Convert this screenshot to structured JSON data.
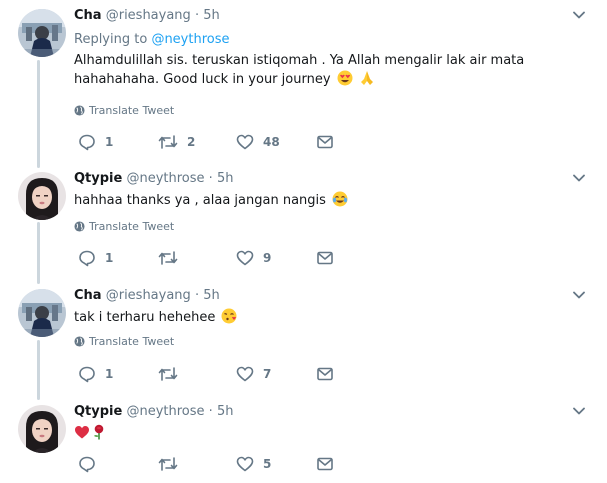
{
  "translate_label": "Translate Tweet",
  "tweets": [
    {
      "name": "Cha",
      "handle": "@rieshayang",
      "separator": "·",
      "time": "5h",
      "replying_prefix": "Replying to",
      "replying_mention": "@neythrose",
      "lines": [
        "Alhamdulillah sis. teruskan istiqomah . Ya Allah mengalir lak air mata",
        "hahahahaha. Good luck in your journey"
      ],
      "emojis": [
        "heart-eyes-emoji",
        "praying-hands-emoji"
      ],
      "counts": {
        "reply": "1",
        "retweet": "2",
        "like": "48"
      }
    },
    {
      "name": "Qtypie",
      "handle": "@neythrose",
      "separator": "·",
      "time": "5h",
      "lines": [
        "hahhaa thanks ya , alaa jangan nangis"
      ],
      "emojis": [
        "tears-of-joy-emoji"
      ],
      "counts": {
        "reply": "1",
        "retweet": "",
        "like": "9"
      }
    },
    {
      "name": "Cha",
      "handle": "@rieshayang",
      "separator": "·",
      "time": "5h",
      "lines": [
        "tak i terharu hehehee"
      ],
      "emojis": [
        "kissing-heart-emoji"
      ],
      "counts": {
        "reply": "1",
        "retweet": "",
        "like": "7"
      }
    },
    {
      "name": "Qtypie",
      "handle": "@neythrose",
      "separator": "·",
      "time": "5h",
      "lines": [
        ""
      ],
      "emojis": [
        "red-heart-emoji",
        "rose-emoji"
      ],
      "counts": {
        "reply": "",
        "retweet": "",
        "like": "5"
      }
    }
  ],
  "colors": {
    "accent": "#1da1f2",
    "muted": "#657786",
    "text": "#14171a",
    "thread": "#ccd6dd"
  }
}
